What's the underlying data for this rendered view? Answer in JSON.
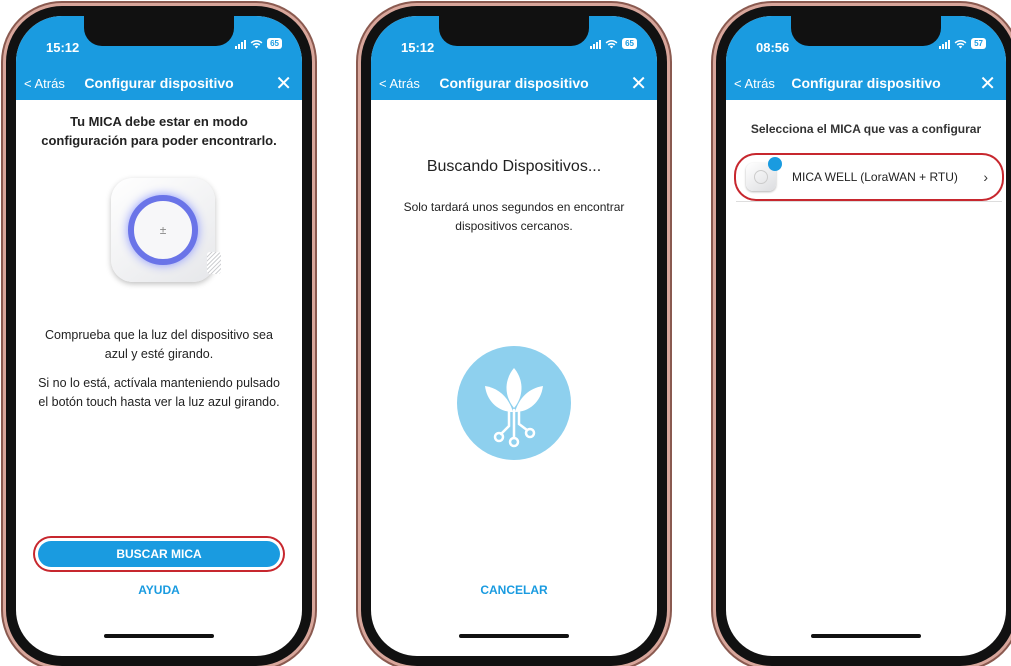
{
  "screens": [
    {
      "status_time": "15:12",
      "battery": "65",
      "nav": {
        "back": "< Atrás",
        "title": "Configurar dispositivo",
        "close": "✕"
      },
      "heading": "Tu MICA debe estar en modo configuración para poder encontrarlo.",
      "paragraph_1": "Comprueba que la luz del dispositivo sea azul y esté girando.",
      "paragraph_2": "Si no lo está, actívala manteniendo pulsado el botón touch hasta ver la luz azul girando.",
      "primary_button": "BUSCAR MICA",
      "secondary_link": "AYUDA"
    },
    {
      "status_time": "15:12",
      "battery": "65",
      "nav": {
        "back": "< Atrás",
        "title": "Configurar dispositivo",
        "close": "✕"
      },
      "heading": "Buscando Dispositivos...",
      "paragraph": "Solo tardará unos segundos en encontrar dispositivos cercanos.",
      "cancel_link": "CANCELAR"
    },
    {
      "status_time": "08:56",
      "battery": "57",
      "nav": {
        "back": "< Atrás",
        "title": "Configurar dispositivo",
        "close": "✕"
      },
      "heading": "Selecciona el MICA que vas a configurar",
      "device_item": {
        "label": "MICA WELL (LoraWAN +  RTU)",
        "chevron": "›"
      }
    }
  ],
  "icons": {
    "device_top_icon": "±",
    "wifi": "📶"
  },
  "colors": {
    "accent": "#1a9be0",
    "highlight": "#c7272e",
    "logo_bg": "#8ed0ee"
  }
}
